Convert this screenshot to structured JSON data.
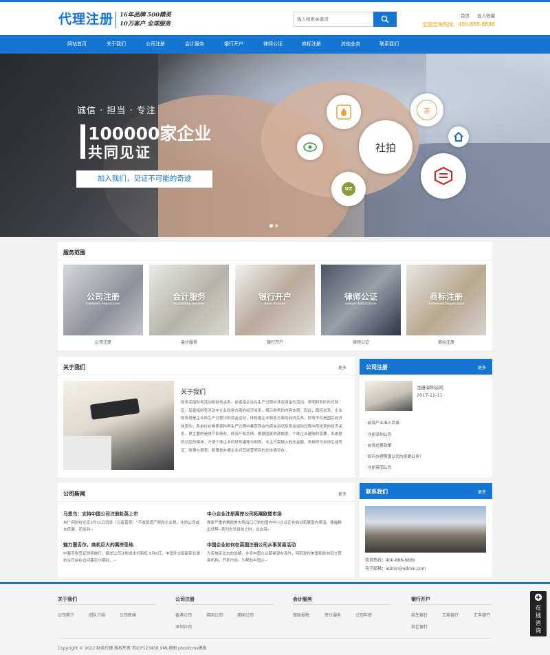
{
  "colors": {
    "brand": "#1575d2",
    "accent": "#f0a000"
  },
  "header": {
    "logo": "代理注册",
    "slogan_line1": "16年品牌 500精英",
    "slogan_line2": "10万客户 全球服务",
    "search_placeholder": "输入搜索关键词",
    "search_icon": "search-icon",
    "link_home": "首页",
    "link_favorite": "加入收藏",
    "hotline": "全国咨询热线：400-888-8888"
  },
  "nav": [
    "网站首页",
    "关于我们",
    "公司注册",
    "会计服务",
    "银行开户",
    "律师公证",
    "商标注册",
    "其他业务",
    "联系我们"
  ],
  "banner": {
    "tagline": "诚信 · 担当 · 专注",
    "headline1": "100000家企业",
    "headline2": "共同见证",
    "button": "加入我们，见证不可能的奇迹",
    "circle_main": "社拍",
    "circle_uz": "UZ",
    "circle_tea": "茶",
    "slide_count": 2,
    "active_slide": 1
  },
  "services": {
    "title": "服务范围",
    "items": [
      {
        "name": "公司注册",
        "en": "Company Registration",
        "caption": "公司注册"
      },
      {
        "name": "会计服务",
        "en": "Accounting Services",
        "caption": "会计服务"
      },
      {
        "name": "银行开户",
        "en": "Bank Account",
        "caption": "银行开户"
      },
      {
        "name": "律师公证",
        "en": "Lawyer Notarization",
        "caption": "律师公证"
      },
      {
        "name": "商标注册",
        "en": "Trademark Registration",
        "caption": "商标注册"
      }
    ]
  },
  "about": {
    "title": "关于我们",
    "more": "更多",
    "subtitle": "关于我们",
    "text": "财务活指财务活动和财务关系。前者指企业在生产过程中涉及资金的活动，表明财务的形式特征；后者指财务活动中企业和各方面的经济关系，揭示财务的内容本质。因此，概括说来，企业财务就是企业再生产过程中的资金运动，体现着企业和各方面的经济关系。财务不仅是国民经济体系的，各单位在物质资料再生产过程中着现存在的资金运动及资金运动过程中所体现的经济关系，更主要的是财产和债务，即资产和负债。根据国家财政制度，个体企业建账的需要，系统提供对应的模块，方便个体企业的财务建账与制表。业主只需输入收支金额，系统即可自动生成凭证，账簿与报表。账簿是办便企业对其经营项目的总体情况在…"
  },
  "company_reg": {
    "title": "公司注册",
    "more": "更多",
    "featured_title": "注册深圳公司",
    "featured_date": "2017-12-11",
    "items": [
      "· 前海产业准入目录",
      "· 注册深圳公司",
      "· 前海优惠政策",
      "· 如何办理美国公司的变更业务？",
      "· 注册英国公司"
    ]
  },
  "news": {
    "title": "公司新闻",
    "more": "更多",
    "items": [
      {
        "title": "马恩乌：支持中国公司注册赴英上市",
        "desc": "央广网财经北京3月11日消息（记者曾琴）“不收取遗产税和企业税，注册公司成本低廉，还能到--"
      },
      {
        "title": "中小企业注册离岸公司拓展欧盟市场",
        "desc": "做家严重依赖欧美市场出口订单的国内中小企业正在尝试拓展国内渠道，德福推出领导--系列办法目前之时，出血海--"
      },
      {
        "title": "魅力塞舌尔，商机巨大的离岸圣地",
        "desc": "中塞互免签证即将施行，离岸公司注册成本创新低 5月6日，中国外交部副部长谢杭生日前在访问塞舌尔期间，--"
      },
      {
        "title": "中国企业如何在英国注册公司从事贸易活动",
        "desc": "为实施走出去的战略，许多中国企业都希望在海外，特别是在美国和欧洲设立贸易机构，开拓市场。为帮助中国企--"
      }
    ]
  },
  "contact": {
    "title": "联系我们",
    "more": "更多",
    "phone": "咨询热线：400-888-8888",
    "email": "电子邮箱：admin@admin.com"
  },
  "footer": {
    "columns": [
      {
        "head": "关于我们",
        "links": [
          "公司简介",
          "团队介绍",
          "公司新闻"
        ]
      },
      {
        "head": "公司注册",
        "links": [
          "香港公司",
          "英国公司",
          "美国公司",
          "深圳公司"
        ]
      },
      {
        "head": "会计服务",
        "links": [
          "做账报税",
          "审计服务",
          "公司年审"
        ]
      },
      {
        "head": "银行开户",
        "links": [
          "招生银行",
          "工商银行",
          "汇丰银行",
          "其它银行"
        ]
      }
    ],
    "copyright": "Copyright © 2022 财务代理 版权所有 苏ICP123456 XML地图 pbootcms模板",
    "float": "在线咨询"
  }
}
